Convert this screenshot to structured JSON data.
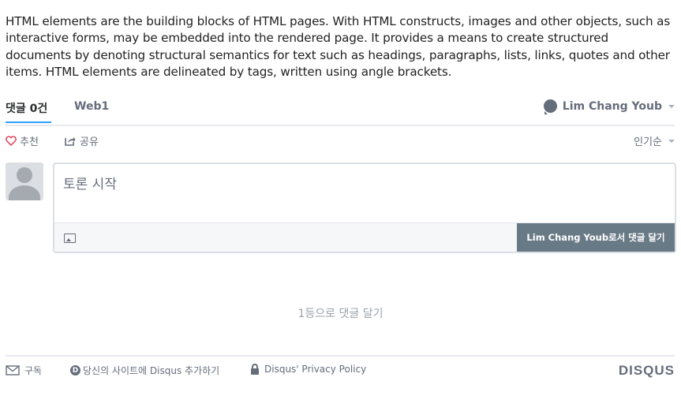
{
  "intro_text": "HTML elements are the building blocks of HTML pages. With HTML constructs, images and other objects, such as interactive forms, may be embedded into the rendered page. It provides a means to create structured documents by denoting structural semantics for text such as headings, paragraphs, lists, links, quotes and other items. HTML elements are delineated by tags, written using angle brackets.",
  "nav": {
    "comments_tab": "댓글 0건",
    "community_tab": "Web1",
    "user_name": "Lim Chang Youb"
  },
  "actions": {
    "recommend": "추천",
    "share": "공유",
    "sort": "인기순"
  },
  "composer": {
    "placeholder": "토론 시작",
    "post_button": "Lim Chang Youb로서 댓글 달기"
  },
  "empty_message": "1등으로 댓글 달기",
  "footer": {
    "subscribe": "구독",
    "add_disqus": "당신의 사이트에 Disqus 추가하기",
    "privacy": "Disqus' Privacy Policy",
    "logo": "DISQUS"
  },
  "colors": {
    "accent": "#2e9fff",
    "post_button_bg": "#687a86",
    "recommend_heart": "#e0364c"
  }
}
